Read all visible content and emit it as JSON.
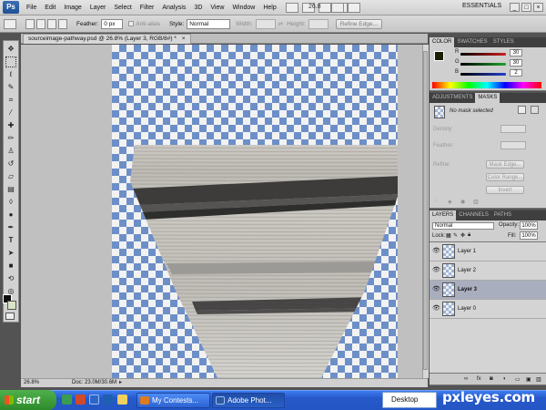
{
  "menu": {
    "app_icon": "Ps",
    "items": [
      "File",
      "Edit",
      "Image",
      "Layer",
      "Select",
      "Filter",
      "Analysis",
      "3D",
      "View",
      "Window",
      "Help"
    ],
    "zoom": "26.8",
    "workspace": "ESSENTIALS"
  },
  "options": {
    "feather_label": "Feather:",
    "feather_value": "0 px",
    "antialias_label": "Anti-alias",
    "style_label": "Style:",
    "style_value": "Normal",
    "width_label": "Width:",
    "height_label": "Height:",
    "refine_edge": "Refine Edge..."
  },
  "document": {
    "tab_title": "sourceimage-pathway.psd @ 26.8% (Layer 3, RGB/8#) *",
    "zoom_status": "26.8%",
    "doc_status": "Doc: 23.0M/30.6M"
  },
  "color_panel": {
    "tabs": [
      "COLOR",
      "SWATCHES",
      "STYLES"
    ],
    "rows": [
      {
        "label": "R",
        "value": "30",
        "color": "#d21f1f"
      },
      {
        "label": "G",
        "value": "30",
        "color": "#1fa52a"
      },
      {
        "label": "B",
        "value": "2",
        "color": "#2440d0"
      }
    ]
  },
  "masks_panel": {
    "tabs": [
      "ADJUSTMENTS",
      "MASKS"
    ],
    "status": "No mask selected",
    "density_label": "Density:",
    "feather_label": "Feather:",
    "refine_label": "Refine:",
    "mask_edge": "Mask Edge...",
    "color_range": "Color Range...",
    "invert": "Invert"
  },
  "layers_panel": {
    "tabs": [
      "LAYERS",
      "CHANNELS",
      "PATHS"
    ],
    "blend_mode": "Normal",
    "opacity_label": "Opacity:",
    "opacity_value": "100%",
    "lock_label": "Lock:",
    "fill_label": "Fill:",
    "fill_value": "100%",
    "layers": [
      {
        "name": "Layer 1",
        "selected": false
      },
      {
        "name": "Layer 2",
        "selected": false
      },
      {
        "name": "Layer 3",
        "selected": true
      },
      {
        "name": "Layer 0",
        "selected": false
      }
    ]
  },
  "taskbar": {
    "start": "start",
    "tasks": [
      "My Contests...",
      "Adobe Phot..."
    ],
    "desktop": "Desktop",
    "watermark": "pxleyes.com"
  }
}
